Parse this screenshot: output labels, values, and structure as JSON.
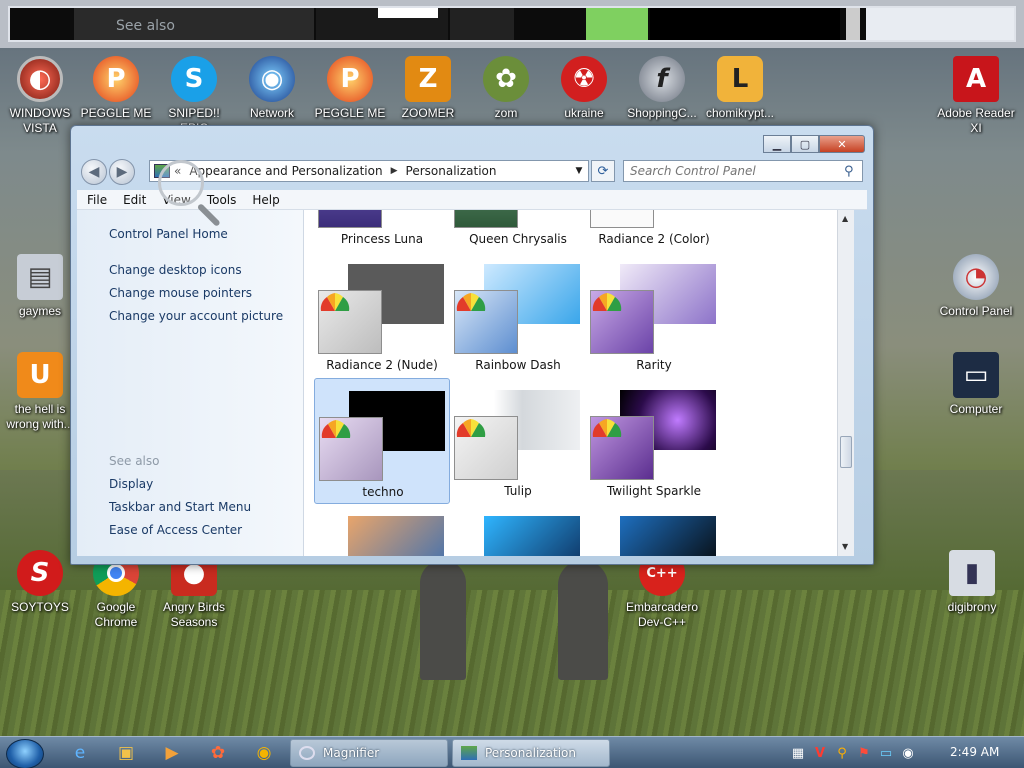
{
  "magnifier": {
    "see_also": "See also"
  },
  "desktop_icons": [
    {
      "label": "WINDOWS VISTA"
    },
    {
      "label": "PEGGLE ME"
    },
    {
      "label": "SNIPED!! EPIC"
    },
    {
      "label": "Network"
    },
    {
      "label": "PEGGLE ME"
    },
    {
      "label": "ZOOMER"
    },
    {
      "label": "zom"
    },
    {
      "label": "ukraine"
    },
    {
      "label": "ShoppingC..."
    },
    {
      "label": "chomikrypt..."
    },
    {
      "label": "Adobe Reader XI"
    },
    {
      "label": "gaymes"
    },
    {
      "label": "Control Panel"
    },
    {
      "label": "the hell is wrong with..."
    },
    {
      "label": "Computer"
    },
    {
      "label": "SOYTOYS"
    },
    {
      "label": "Google Chrome"
    },
    {
      "label": "Angry Birds Seasons"
    },
    {
      "label": "Embarcadero Dev-C++"
    },
    {
      "label": "digibrony"
    }
  ],
  "window": {
    "address": {
      "overflow": "«",
      "crumbs": [
        "Appearance and Personalization",
        "Personalization"
      ]
    },
    "search_placeholder": "Search Control Panel",
    "menu": [
      "File",
      "Edit",
      "View",
      "Tools",
      "Help"
    ],
    "left_pane": {
      "home": "Control Panel Home",
      "links": [
        "Change desktop icons",
        "Change mouse pointers",
        "Change your account picture"
      ],
      "see_also_header": "See also",
      "see_also": [
        "Display",
        "Taskbar and Start Menu",
        "Ease of Access Center"
      ]
    },
    "themes": [
      {
        "name": "Princess Luna"
      },
      {
        "name": "Queen Chrysalis"
      },
      {
        "name": "Radiance 2 (Color)"
      },
      {
        "name": "Radiance 2 (Nude)"
      },
      {
        "name": "Rainbow Dash"
      },
      {
        "name": "Rarity"
      },
      {
        "name": "techno"
      },
      {
        "name": "Tulip"
      },
      {
        "name": "Twilight Sparkle"
      }
    ]
  },
  "taskbar": {
    "tasks": [
      {
        "label": "Magnifier"
      },
      {
        "label": "Personalization"
      }
    ],
    "clock": "2:49 AM"
  }
}
